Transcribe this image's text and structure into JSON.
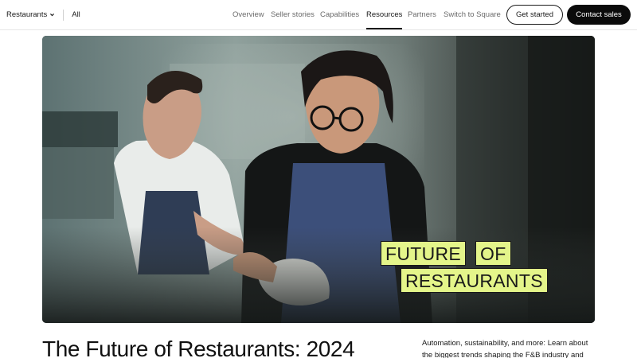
{
  "nav": {
    "vertical_label": "Restaurants",
    "all_label": "All",
    "links": [
      "Overview",
      "Seller stories",
      "Capabilities",
      "Resources",
      "Partners",
      "Switch to Square"
    ],
    "active_link": "Resources",
    "get_started": "Get started",
    "contact_sales": "Contact sales"
  },
  "hero": {
    "badge_line1_a": "FUTURE",
    "badge_line1_b": "OF",
    "badge_line2": "RESTAURANTS",
    "badge_color": "#e4f58a"
  },
  "article": {
    "title": "The Future of Restaurants: 2024",
    "description": "Automation, sustainability, and more: Learn about the biggest trends shaping the F&B industry and"
  }
}
